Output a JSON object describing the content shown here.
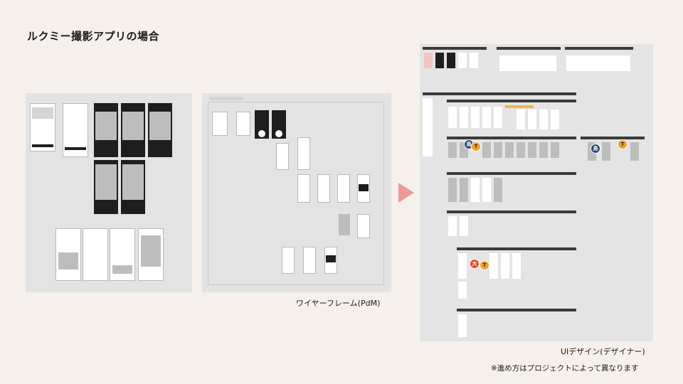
{
  "page": {
    "title": "ルクミー撮影アプリの場合",
    "wireframe_caption": "ワイヤーフレーム(PdM)",
    "ui_caption": "UIデザイン(デザイナー)",
    "note": "※進め方はプロジェクトによって異なります"
  },
  "colors": {
    "background": "#f5f0eb",
    "board": "#e3e3e3",
    "arrow": "#ec9a9a",
    "badge_navy": "#2f4a78",
    "badge_orange": "#f0a02a",
    "badge_red": "#e1472e"
  },
  "badges": [
    {
      "label": "鳥",
      "color": "navy"
    },
    {
      "label": "T",
      "color": "orange"
    },
    {
      "label": "鳥",
      "color": "navy"
    },
    {
      "label": "T",
      "color": "orange"
    },
    {
      "label": "大",
      "color": "red"
    },
    {
      "label": "T",
      "color": "orange"
    }
  ]
}
